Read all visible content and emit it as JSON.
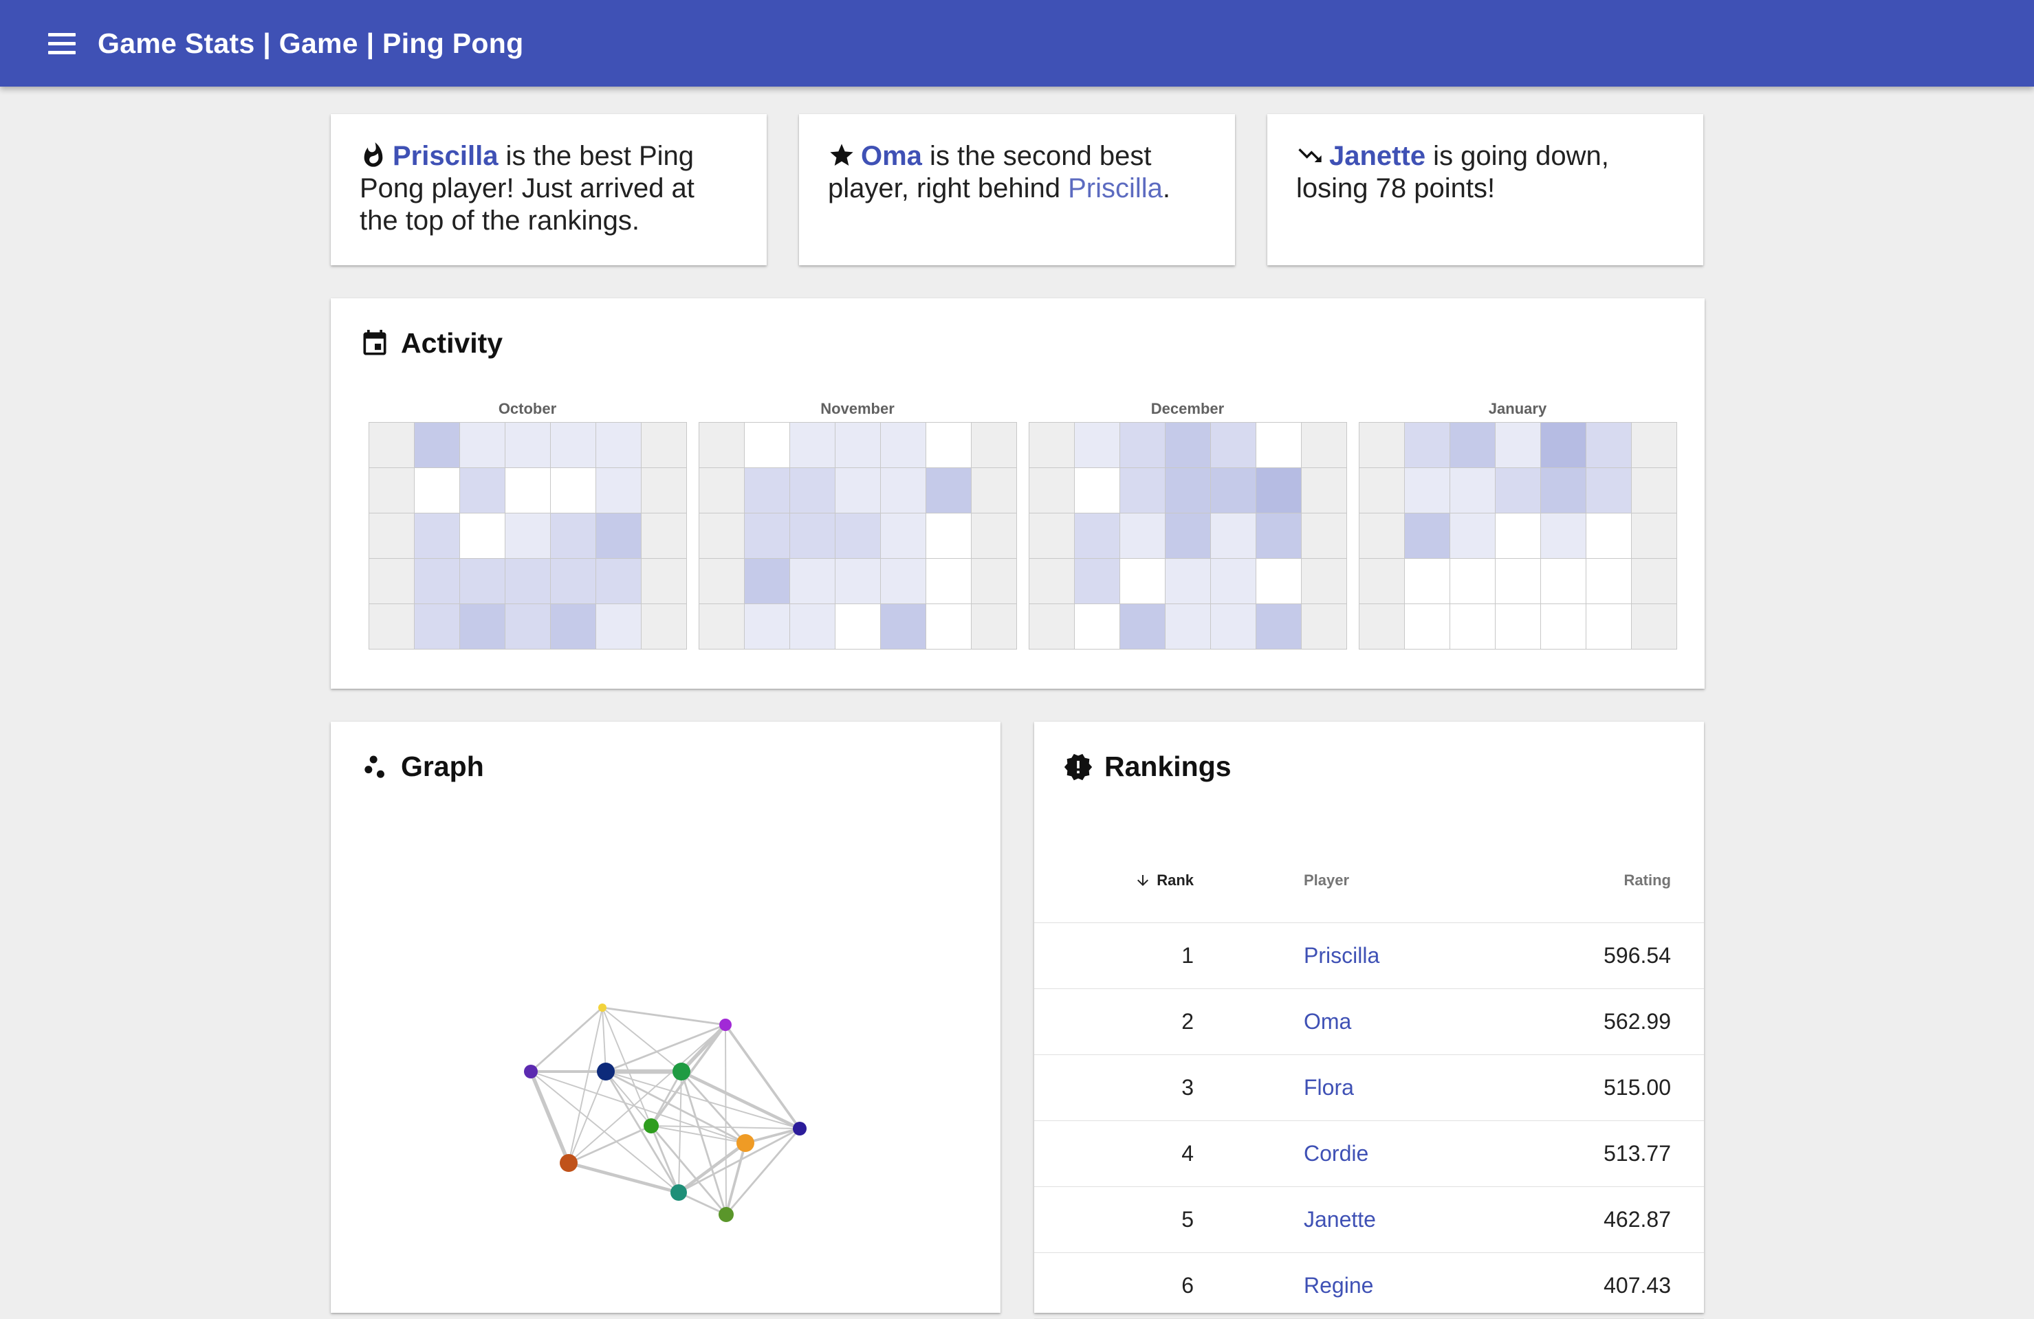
{
  "appbar": {
    "title": "Game Stats | Game | Ping Pong"
  },
  "insights": [
    {
      "icon": "fire-icon",
      "name": "Priscilla",
      "text": " is the best Ping Pong player! Just arrived at the top of the rankings."
    },
    {
      "icon": "star-icon",
      "name": "Oma",
      "text": " is the second best player, right behind ",
      "link": "Priscilla",
      "tail": "."
    },
    {
      "icon": "trending-down-icon",
      "name": "Janette",
      "text": " is going down, losing 78 points!"
    }
  ],
  "activity": {
    "title": "Activity",
    "icon": "calendar-icon",
    "months": [
      {
        "name": "October",
        "cells": [
          [
            -1,
            3,
            1,
            1,
            1,
            1,
            -1
          ],
          [
            -1,
            0,
            2,
            0,
            0,
            1,
            -1
          ],
          [
            -1,
            2,
            0,
            1,
            2,
            3,
            -1
          ],
          [
            -1,
            2,
            2,
            2,
            2,
            2,
            -1
          ],
          [
            -1,
            2,
            3,
            2,
            3,
            1,
            -1
          ]
        ]
      },
      {
        "name": "November",
        "cells": [
          [
            -1,
            0,
            1,
            1,
            1,
            0,
            -1
          ],
          [
            -1,
            2,
            2,
            1,
            1,
            3,
            -1
          ],
          [
            -1,
            2,
            2,
            2,
            1,
            0,
            -1
          ],
          [
            -1,
            3,
            1,
            1,
            1,
            0,
            -1
          ],
          [
            -1,
            1,
            1,
            0,
            3,
            0,
            -1
          ]
        ]
      },
      {
        "name": "December",
        "cells": [
          [
            -1,
            1,
            2,
            3,
            2,
            0,
            -1
          ],
          [
            -1,
            0,
            2,
            3,
            3,
            4,
            -1
          ],
          [
            -1,
            2,
            1,
            3,
            1,
            3,
            -1
          ],
          [
            -1,
            2,
            0,
            1,
            1,
            0,
            -1
          ],
          [
            -1,
            0,
            3,
            1,
            1,
            3,
            -1
          ]
        ]
      },
      {
        "name": "January",
        "cells": [
          [
            -1,
            2,
            3,
            1,
            4,
            2,
            -1
          ],
          [
            -1,
            1,
            1,
            2,
            3,
            2,
            -1
          ],
          [
            -1,
            3,
            1,
            0,
            1,
            0,
            -1
          ],
          [
            -1,
            0,
            0,
            0,
            0,
            0,
            -1
          ],
          [
            -1,
            0,
            0,
            0,
            0,
            0,
            -1
          ]
        ]
      }
    ]
  },
  "graph": {
    "title": "Graph",
    "icon": "scatter-icon",
    "nodes": [
      {
        "id": "n1",
        "color": "#f2d33c"
      },
      {
        "id": "n2",
        "color": "#a12ad6"
      },
      {
        "id": "n3",
        "color": "#5c2ab0"
      },
      {
        "id": "n4",
        "color": "#0d2a7a"
      },
      {
        "id": "n5",
        "color": "#1f9b42"
      },
      {
        "id": "n6",
        "color": "#2c1c9a"
      },
      {
        "id": "n7",
        "color": "#2e9d1e"
      },
      {
        "id": "n8",
        "color": "#ef9b25"
      },
      {
        "id": "n9",
        "color": "#c0521a"
      },
      {
        "id": "n10",
        "color": "#1f8f78"
      },
      {
        "id": "n11",
        "color": "#5a962a"
      }
    ]
  },
  "rankings": {
    "title": "Rankings",
    "icon": "badge-alert-icon",
    "columns": {
      "rank": "Rank",
      "player": "Player",
      "rating": "Rating"
    },
    "rows": [
      {
        "rank": "1",
        "player": "Priscilla",
        "rating": "596.54"
      },
      {
        "rank": "2",
        "player": "Oma",
        "rating": "562.99"
      },
      {
        "rank": "3",
        "player": "Flora",
        "rating": "515.00"
      },
      {
        "rank": "4",
        "player": "Cordie",
        "rating": "513.77"
      },
      {
        "rank": "5",
        "player": "Janette",
        "rating": "462.87"
      },
      {
        "rank": "6",
        "player": "Regine",
        "rating": "407.43"
      }
    ]
  }
}
